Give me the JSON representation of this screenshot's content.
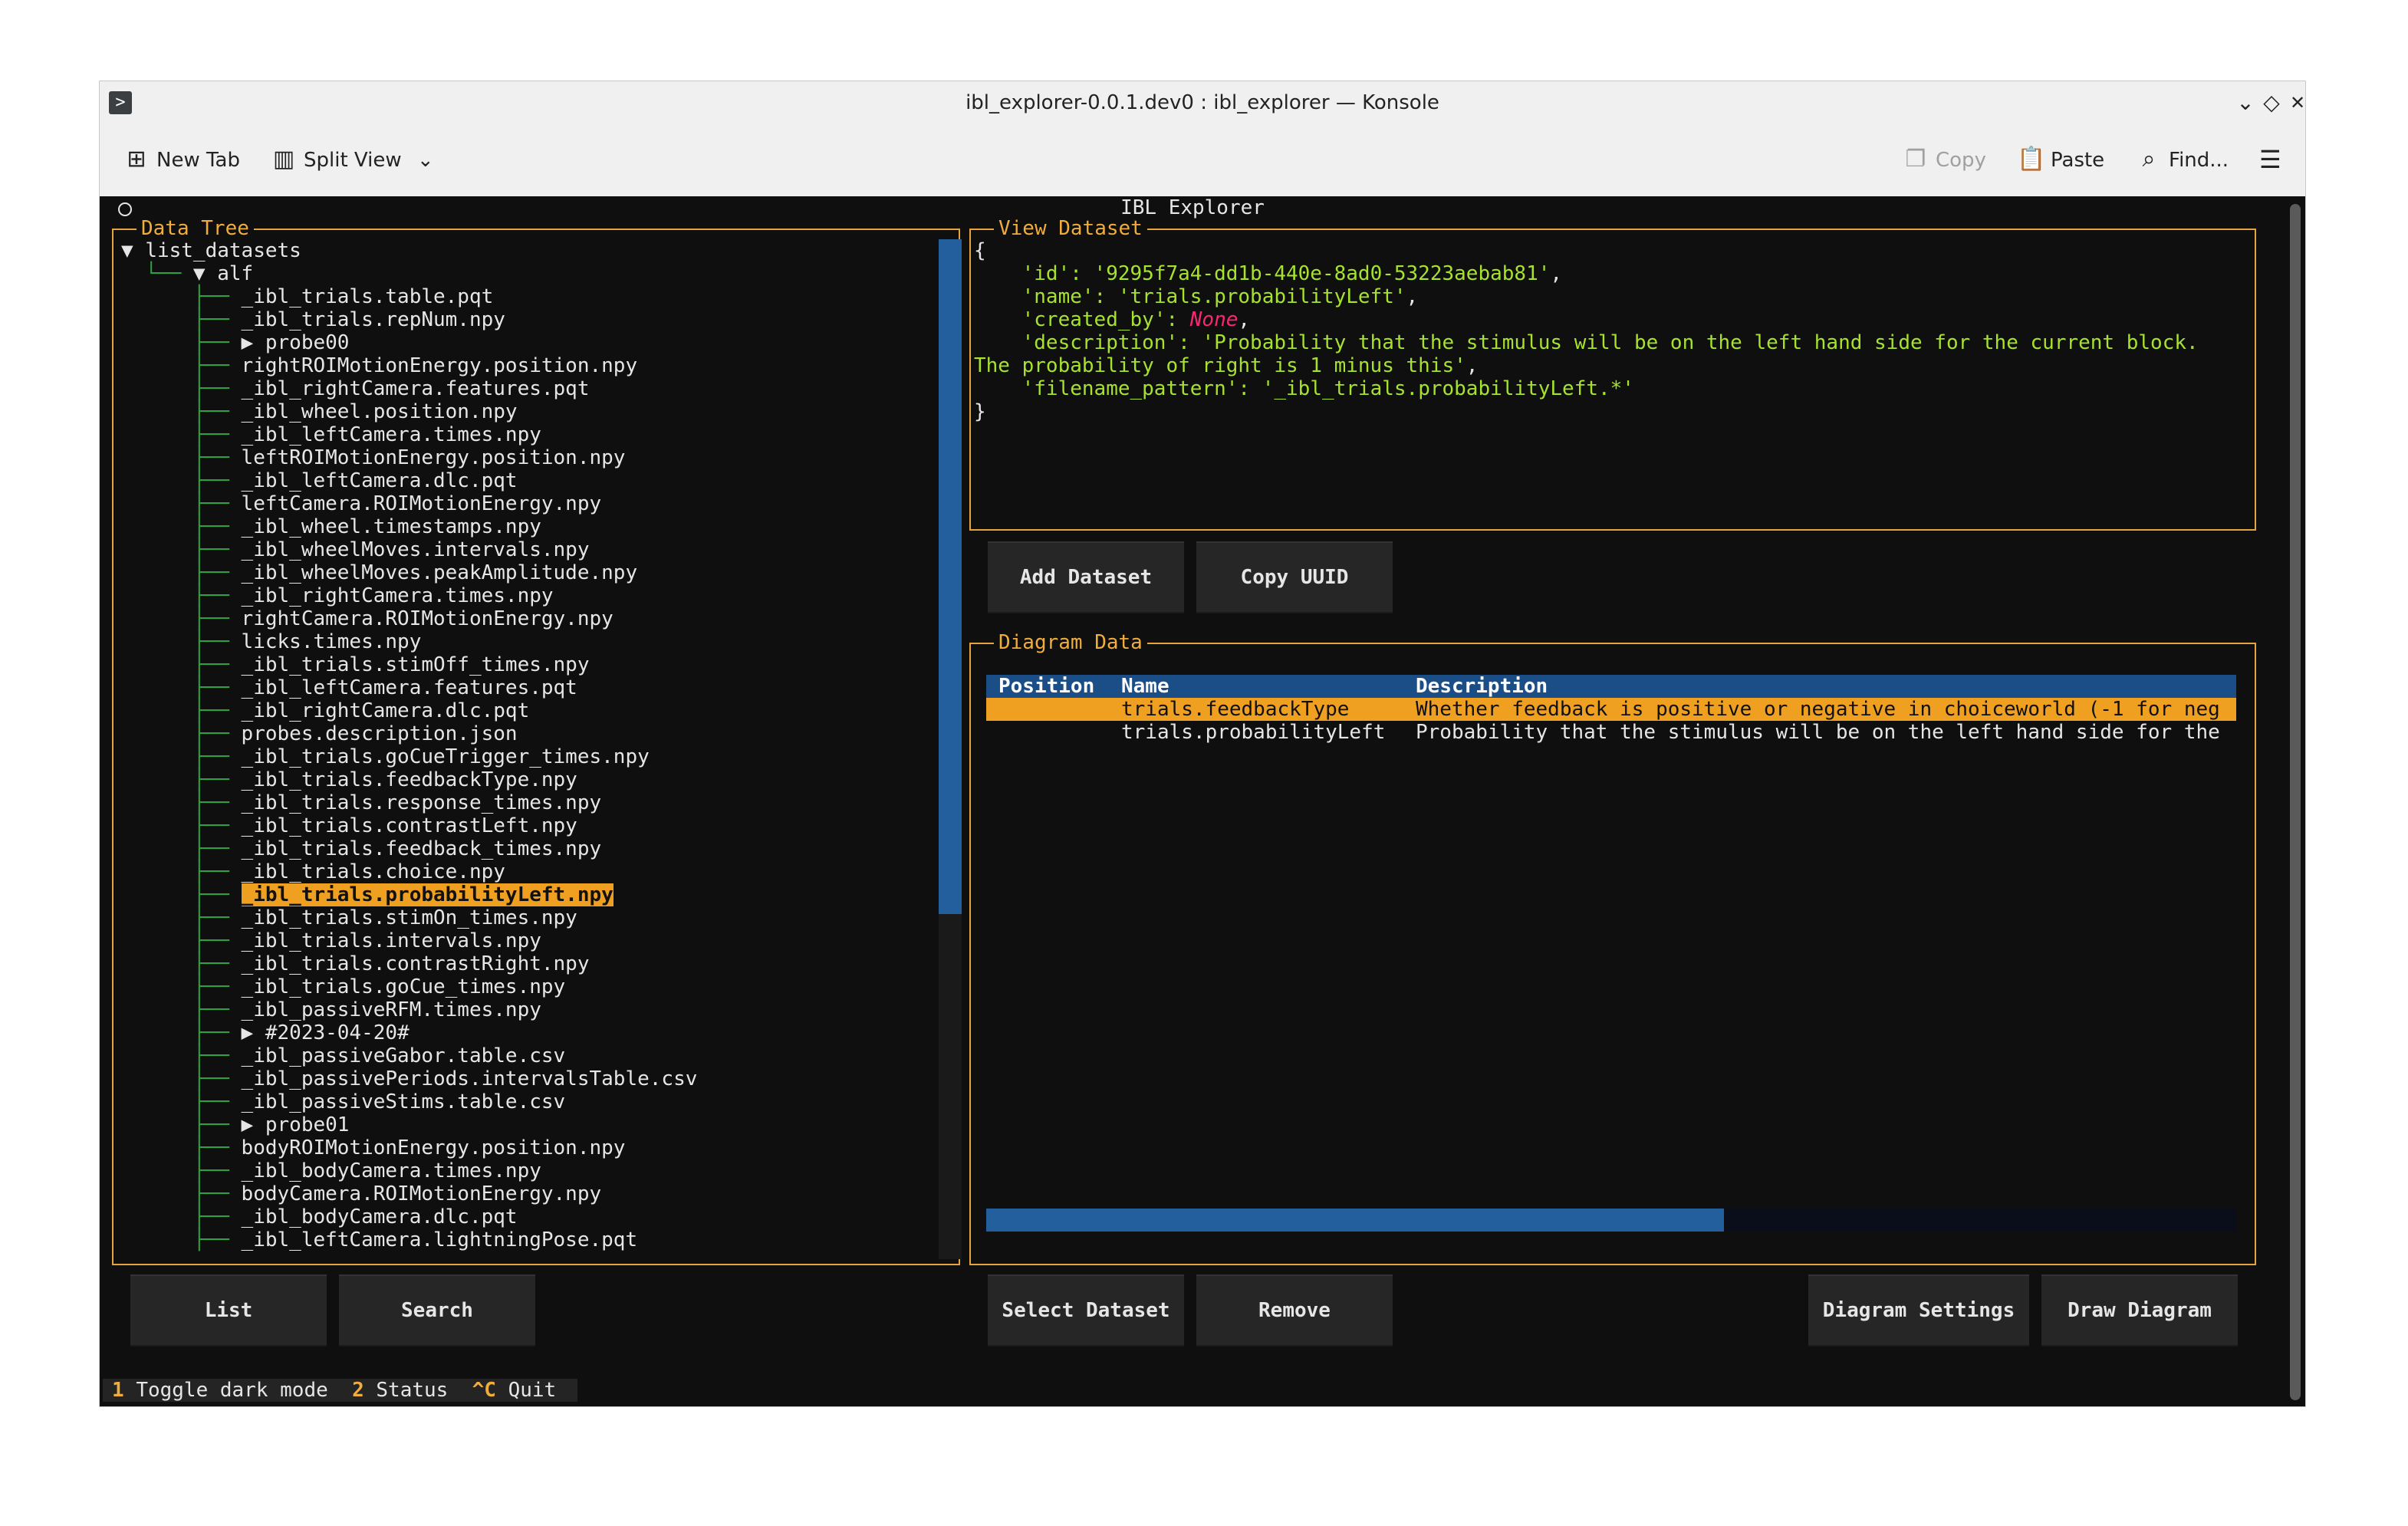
{
  "window": {
    "title": "ibl_explorer-0.0.1.dev0 : ibl_explorer — Konsole"
  },
  "toolbar": {
    "new_tab": "New Tab",
    "split_view": "Split View",
    "copy": "Copy",
    "paste": "Paste",
    "find": "Find..."
  },
  "app": {
    "title": "IBL Explorer"
  },
  "data_tree": {
    "title": "Data Tree",
    "root": "list_datasets",
    "folder": "alf",
    "items": [
      "_ibl_trials.table.pqt",
      "_ibl_trials.repNum.npy",
      "probe00",
      "rightROIMotionEnergy.position.npy",
      "_ibl_rightCamera.features.pqt",
      "_ibl_wheel.position.npy",
      "_ibl_leftCamera.times.npy",
      "leftROIMotionEnergy.position.npy",
      "_ibl_leftCamera.dlc.pqt",
      "leftCamera.ROIMotionEnergy.npy",
      "_ibl_wheel.timestamps.npy",
      "_ibl_wheelMoves.intervals.npy",
      "_ibl_wheelMoves.peakAmplitude.npy",
      "_ibl_rightCamera.times.npy",
      "rightCamera.ROIMotionEnergy.npy",
      "licks.times.npy",
      "_ibl_trials.stimOff_times.npy",
      "_ibl_leftCamera.features.pqt",
      "_ibl_rightCamera.dlc.pqt",
      "probes.description.json",
      "_ibl_trials.goCueTrigger_times.npy",
      "_ibl_trials.feedbackType.npy",
      "_ibl_trials.response_times.npy",
      "_ibl_trials.contrastLeft.npy",
      "_ibl_trials.feedback_times.npy",
      "_ibl_trials.choice.npy",
      "_ibl_trials.probabilityLeft.npy",
      "_ibl_trials.stimOn_times.npy",
      "_ibl_trials.intervals.npy",
      "_ibl_trials.contrastRight.npy",
      "_ibl_trials.goCue_times.npy",
      "_ibl_passiveRFM.times.npy",
      "#2023-04-20#",
      "_ibl_passiveGabor.table.csv",
      "_ibl_passivePeriods.intervalsTable.csv",
      "_ibl_passiveStims.table.csv",
      "probe01",
      "bodyROIMotionEnergy.position.npy",
      "_ibl_bodyCamera.times.npy",
      "bodyCamera.ROIMotionEnergy.npy",
      "_ibl_bodyCamera.dlc.pqt",
      "_ibl_leftCamera.lightningPose.pqt"
    ]
  },
  "view_dataset": {
    "title": "View Dataset",
    "open_brace": "{",
    "close_brace": "}",
    "id_key": "'id': ",
    "id_value": "'9295f7a4-dd1b-440e-8ad0-53223aebab81'",
    "name_key": "'name': ",
    "name_value": "'trials.probabilityLeft'",
    "created_by_key": "'created_by': ",
    "created_by_value": "None",
    "description_key": "'description': ",
    "description_value_1": "'Probability that the stimulus will be on the left hand side for the current block.",
    "description_value_2": "The probability of right is 1 minus this'",
    "filename_pattern_key": "'filename_pattern': ",
    "filename_pattern_value": "'_ibl_trials.probabilityLeft.*'"
  },
  "buttons": {
    "add_dataset": "Add Dataset",
    "copy_uuid": "Copy UUID",
    "list": "List",
    "search": "Search",
    "select_dataset": "Select Dataset",
    "remove": "Remove",
    "diagram_settings": "Diagram Settings",
    "draw_diagram": "Draw Diagram"
  },
  "diagram_data": {
    "title": "Diagram Data",
    "columns": [
      "Position",
      "Name",
      "Description"
    ],
    "rows": [
      {
        "position": "",
        "name": "trials.feedbackType",
        "description": "Whether feedback is positive or negative in choiceworld (-1 for neg"
      },
      {
        "position": "",
        "name": "trials.probabilityLeft",
        "description": "Probability that the stimulus will be on the left hand side for the"
      }
    ],
    "scroll_fraction": 0.59
  },
  "footer": {
    "k1": "1",
    "l1": "Toggle dark mode",
    "k2": "2",
    "l2": "Status",
    "k3": "^C",
    "l3": "Quit"
  },
  "colors": {
    "accent": "#f0ad3c",
    "highlight": "#f0a021",
    "tree_guide": "#2ea043",
    "table_header": "#1b4e86",
    "string": "#a6e22e",
    "none": "#f92672"
  }
}
